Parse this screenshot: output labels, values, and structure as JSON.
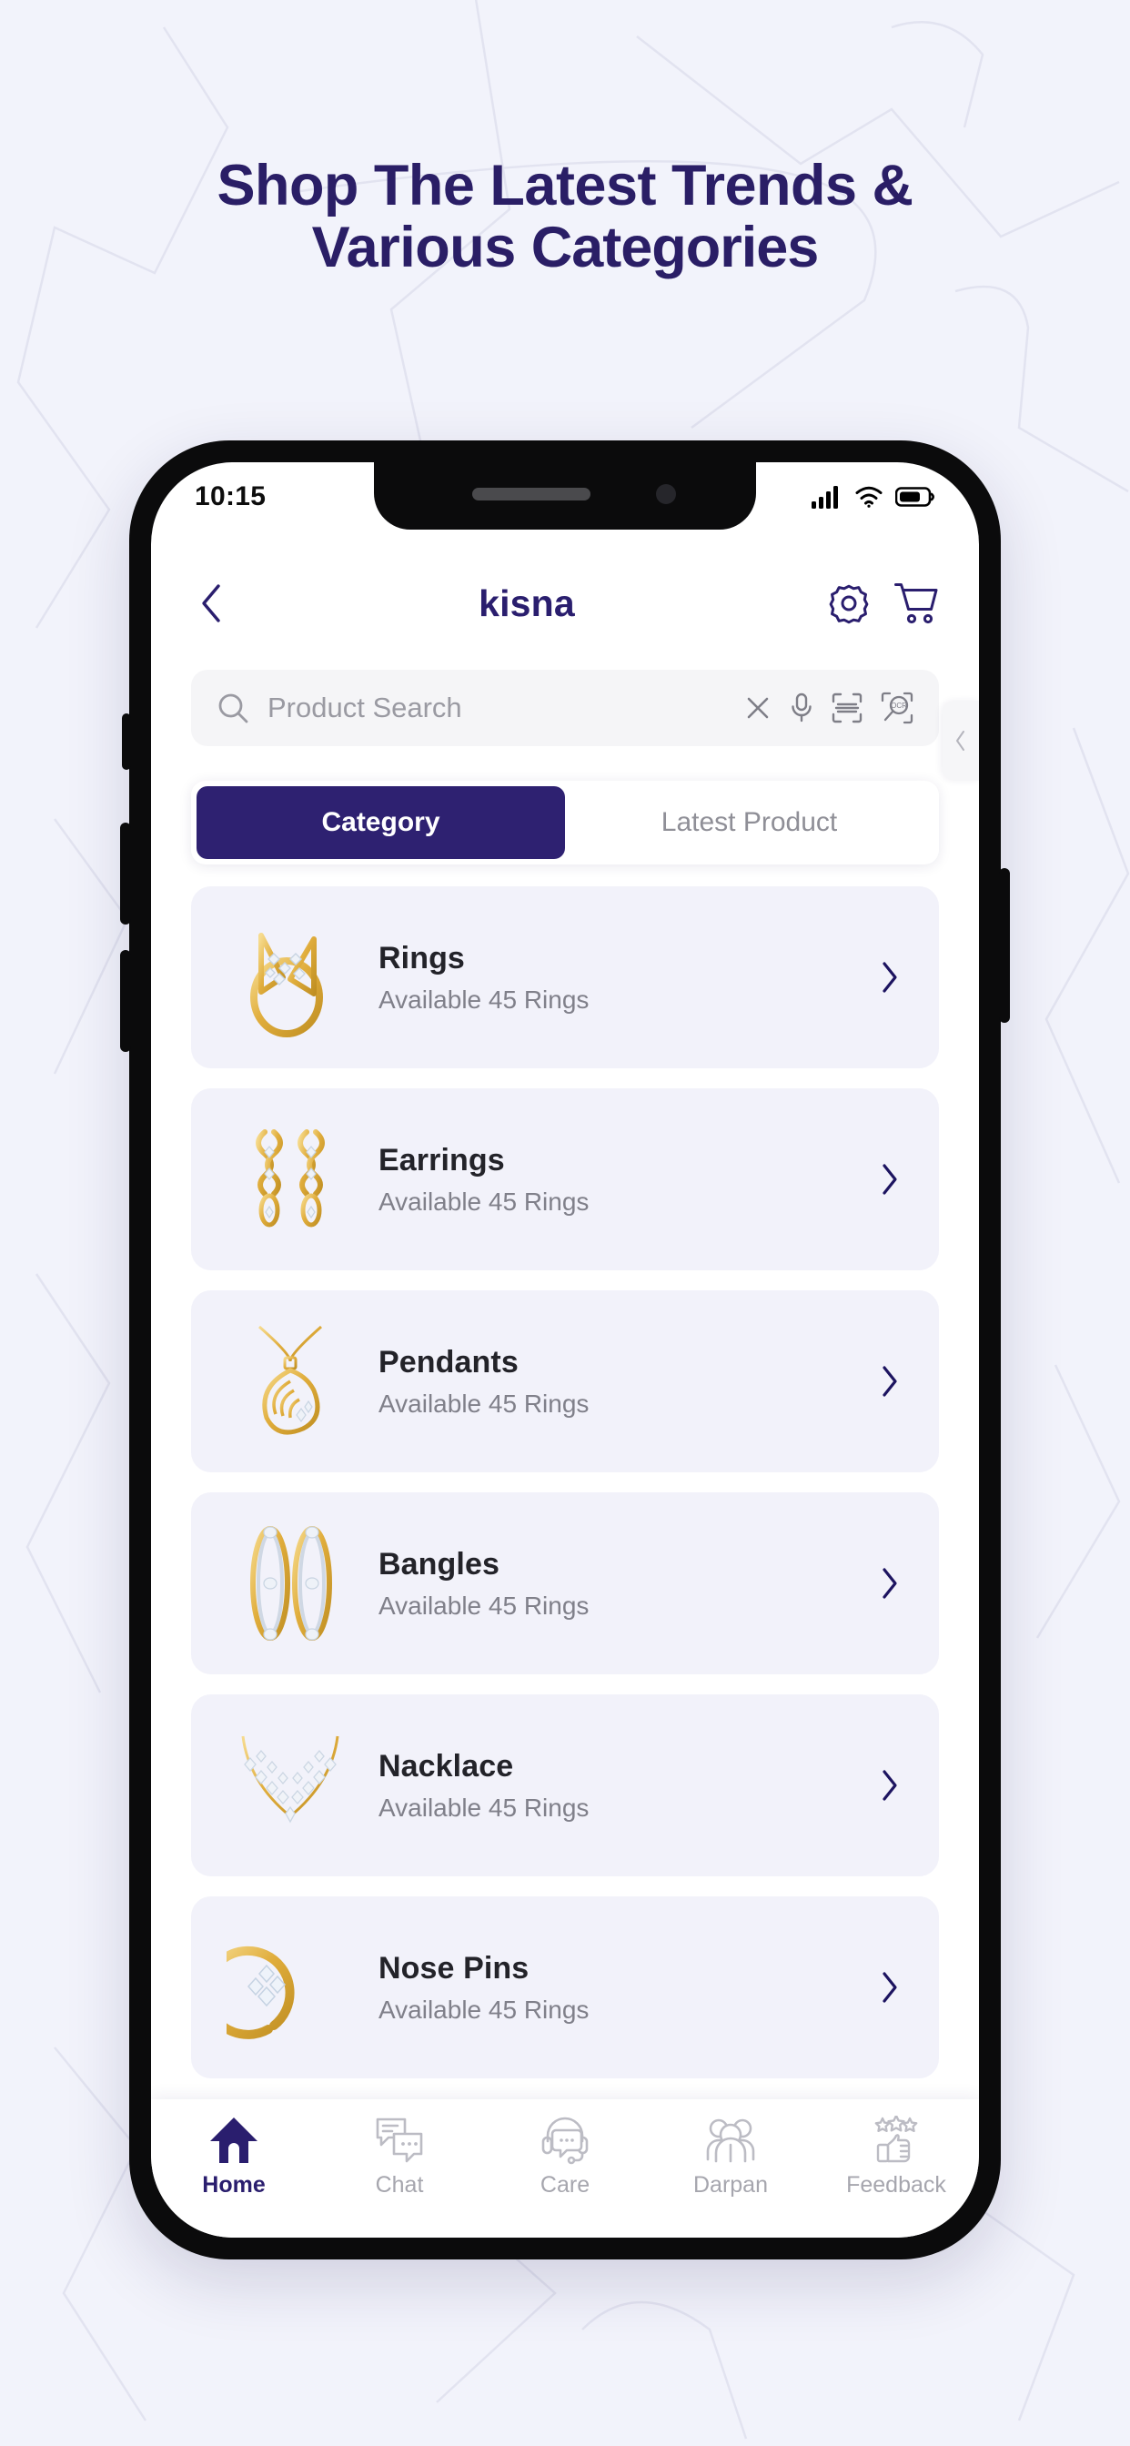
{
  "theme": {
    "page_bg": "#f2f3fb",
    "brand_navy": "#2a1e6e",
    "accent_navy": "#2e2171",
    "card_bg": "#f2f2fa",
    "muted_text": "#80808a",
    "gold": "#e0b049"
  },
  "headline": {
    "line1": "Shop The Latest Trends &",
    "line2_prefix": "Various ",
    "line2_emphasis": "Categories"
  },
  "status_bar": {
    "time": "10:15",
    "icons": [
      "signal-bars-icon",
      "wifi-icon",
      "battery-icon"
    ]
  },
  "app_header": {
    "back_icon": "chevron-left-icon",
    "brand": "kisna",
    "settings_icon": "gear-icon",
    "cart_icon": "shopping-cart-icon"
  },
  "search": {
    "placeholder": "Product Search",
    "value": "",
    "leading_icon": "search-icon",
    "actions": [
      "close-icon",
      "microphone-icon",
      "barcode-scan-icon",
      "ocr-scan-icon"
    ]
  },
  "tabs": [
    {
      "label": "Category",
      "active": true
    },
    {
      "label": "Latest Product",
      "active": false
    }
  ],
  "side_handle": {
    "icon": "chevron-left-icon"
  },
  "categories": [
    {
      "title": "Rings",
      "subtitle": "Available 45 Rings",
      "thumb": "ring-icon",
      "arrow": "chevron-right-icon"
    },
    {
      "title": "Earrings",
      "subtitle": "Available 45 Rings",
      "thumb": "earrings-icon",
      "arrow": "chevron-right-icon"
    },
    {
      "title": "Pendants",
      "subtitle": "Available 45 Rings",
      "thumb": "pendant-icon",
      "arrow": "chevron-right-icon"
    },
    {
      "title": "Bangles",
      "subtitle": "Available 45 Rings",
      "thumb": "bangles-icon",
      "arrow": "chevron-right-icon"
    },
    {
      "title": "Nacklace",
      "subtitle": "Available 45 Rings",
      "thumb": "necklace-icon",
      "arrow": "chevron-right-icon"
    },
    {
      "title": "Nose Pins",
      "subtitle": "Available 45 Rings",
      "thumb": "nosepin-icon",
      "arrow": "chevron-right-icon"
    }
  ],
  "bottom_nav": [
    {
      "label": "Home",
      "icon": "home-icon",
      "active": true
    },
    {
      "label": "Chat",
      "icon": "chat-icon",
      "active": false
    },
    {
      "label": "Care",
      "icon": "headset-icon",
      "active": false
    },
    {
      "label": "Darpan",
      "icon": "people-icon",
      "active": false
    },
    {
      "label": "Feedback",
      "icon": "thumbs-up-icon",
      "active": false
    }
  ]
}
